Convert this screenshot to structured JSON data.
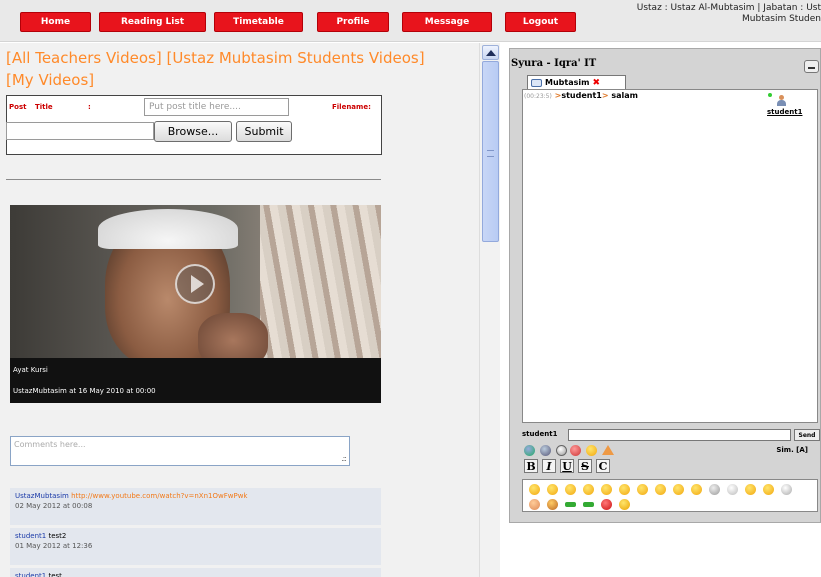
{
  "nav": {
    "home": "Home",
    "reading_list": "Reading List",
    "timetable": "Timetable",
    "profile": "Profile",
    "message": "Message",
    "logout": "Logout"
  },
  "user_info": {
    "line1": "Ustaz : Ustaz Al-Mubtasim | Jabatan : Ust",
    "line2": "Mubtasim Studen"
  },
  "video_links": {
    "all_teachers": "[All Teachers Videos]",
    "students": "[Ustaz Mubtasim Students Videos]",
    "my_videos": "[My Videos]"
  },
  "post_form": {
    "post_label": "Post",
    "title_label": "Title",
    "colon": ":",
    "title_placeholder": "Put post title here....",
    "filename_label": "Filename:",
    "browse_label": "Browse...",
    "submit_label": "Submit"
  },
  "video": {
    "title": "Ayat Kursi",
    "meta": "UstazMubtasim at 16 May 2010 at 00:00"
  },
  "comment_box": {
    "placeholder": "Comments here...",
    "grip": ".::"
  },
  "comments": [
    {
      "user": "UstazMubtasim",
      "link": "http://www.youtube.com/watch?v=nXn1OwFwPwk",
      "date": "02 May 2012 at 00:08"
    },
    {
      "user": "student1",
      "text": "test2",
      "date": "01 May 2012 at 12:36"
    },
    {
      "user": "student1",
      "text": "test",
      "date": ""
    }
  ],
  "chat": {
    "title": "Syura - Iqra' IT",
    "tab_label": "Mubtasim",
    "tab_close": "✖",
    "message": {
      "time": "(00:23:5)",
      "user": "student1",
      "arrow": ">",
      "text": "salam"
    },
    "online_user": "student1",
    "input_label": "student1",
    "send_label": "Send",
    "size_label": "Sim. [A]",
    "format_buttons": [
      "B",
      "I",
      "U",
      "S",
      "C"
    ]
  },
  "colors": {
    "nav_red": "#e8141c",
    "link_orange": "#ff8a2a",
    "chat_panel": "#d4d4d4"
  }
}
